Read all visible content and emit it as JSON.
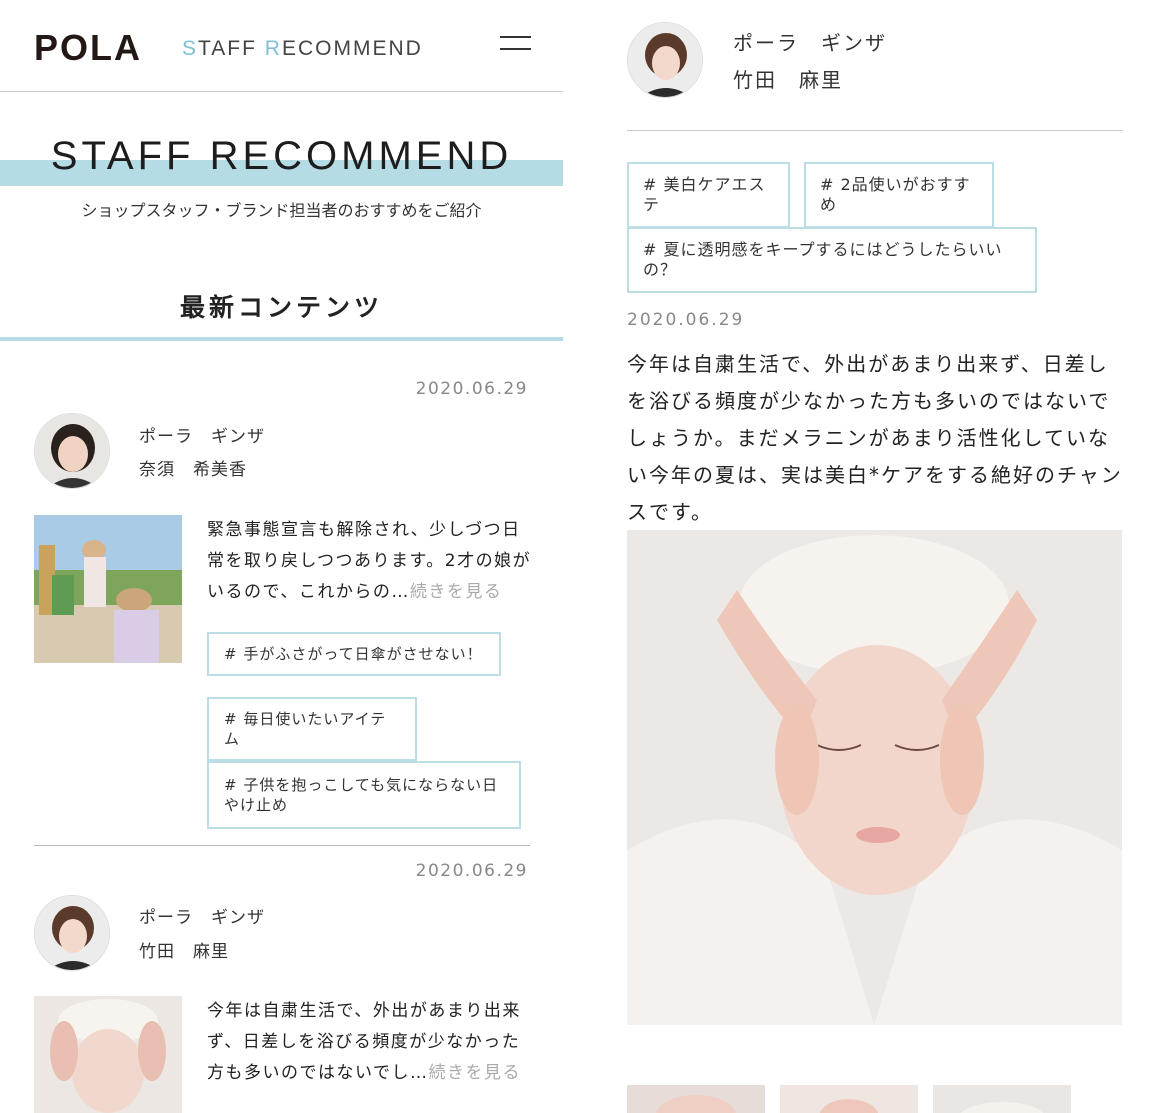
{
  "header": {
    "logo": "POLA",
    "subtitle_s": "S",
    "subtitle_taff": "TAFF ",
    "subtitle_r": "R",
    "subtitle_ecommend": "ECOMMEND"
  },
  "hero": {
    "title": "STAFF RECOMMEND",
    "subtitle": "ショップスタッフ・ブランド担当者のおすすめをご紹介"
  },
  "section": {
    "title": "最新コンテンツ"
  },
  "articles": [
    {
      "date": "2020.06.29",
      "store": "ポーラ　ギンザ",
      "name": "奈須　希美香",
      "excerpt": "緊急事態宣言も解除され、少しづつ日常を取り戻しつつあります。2才の娘がいるので、これからの…",
      "more": "続きを見る",
      "tags": [
        "# 手がふさがって日傘がさせない！",
        "# 毎日使いたいアイテム",
        "# 子供を抱っこしても気にならない日やけ止め"
      ]
    },
    {
      "date": "2020.06.29",
      "store": "ポーラ　ギンザ",
      "name": "竹田　麻里",
      "excerpt": "今年は自粛生活で、外出があまり出来ず、日差しを浴びる頻度が少なかった方も多いのではないでし…",
      "more": "続きを見る"
    }
  ],
  "detail": {
    "store": "ポーラ　ギンザ",
    "name": "竹田　麻里",
    "tags": [
      "# 美白ケアエステ",
      "# 2品使いがおすすめ",
      "# 夏に透明感をキープするにはどうしたらいいの？"
    ],
    "date": "2020.06.29",
    "body": "今年は自粛生活で、外出があまり出来ず、日差しを浴びる頻度が少なかった方も多いのではないでしょうか。まだメラニンがあまり活性化していない今年の夏は、実は美白*ケアをする絶好のチャンスです。"
  },
  "colors": {
    "accent": "#b5dbe5",
    "tag_border": "#bcdde6",
    "muted": "#888888"
  }
}
